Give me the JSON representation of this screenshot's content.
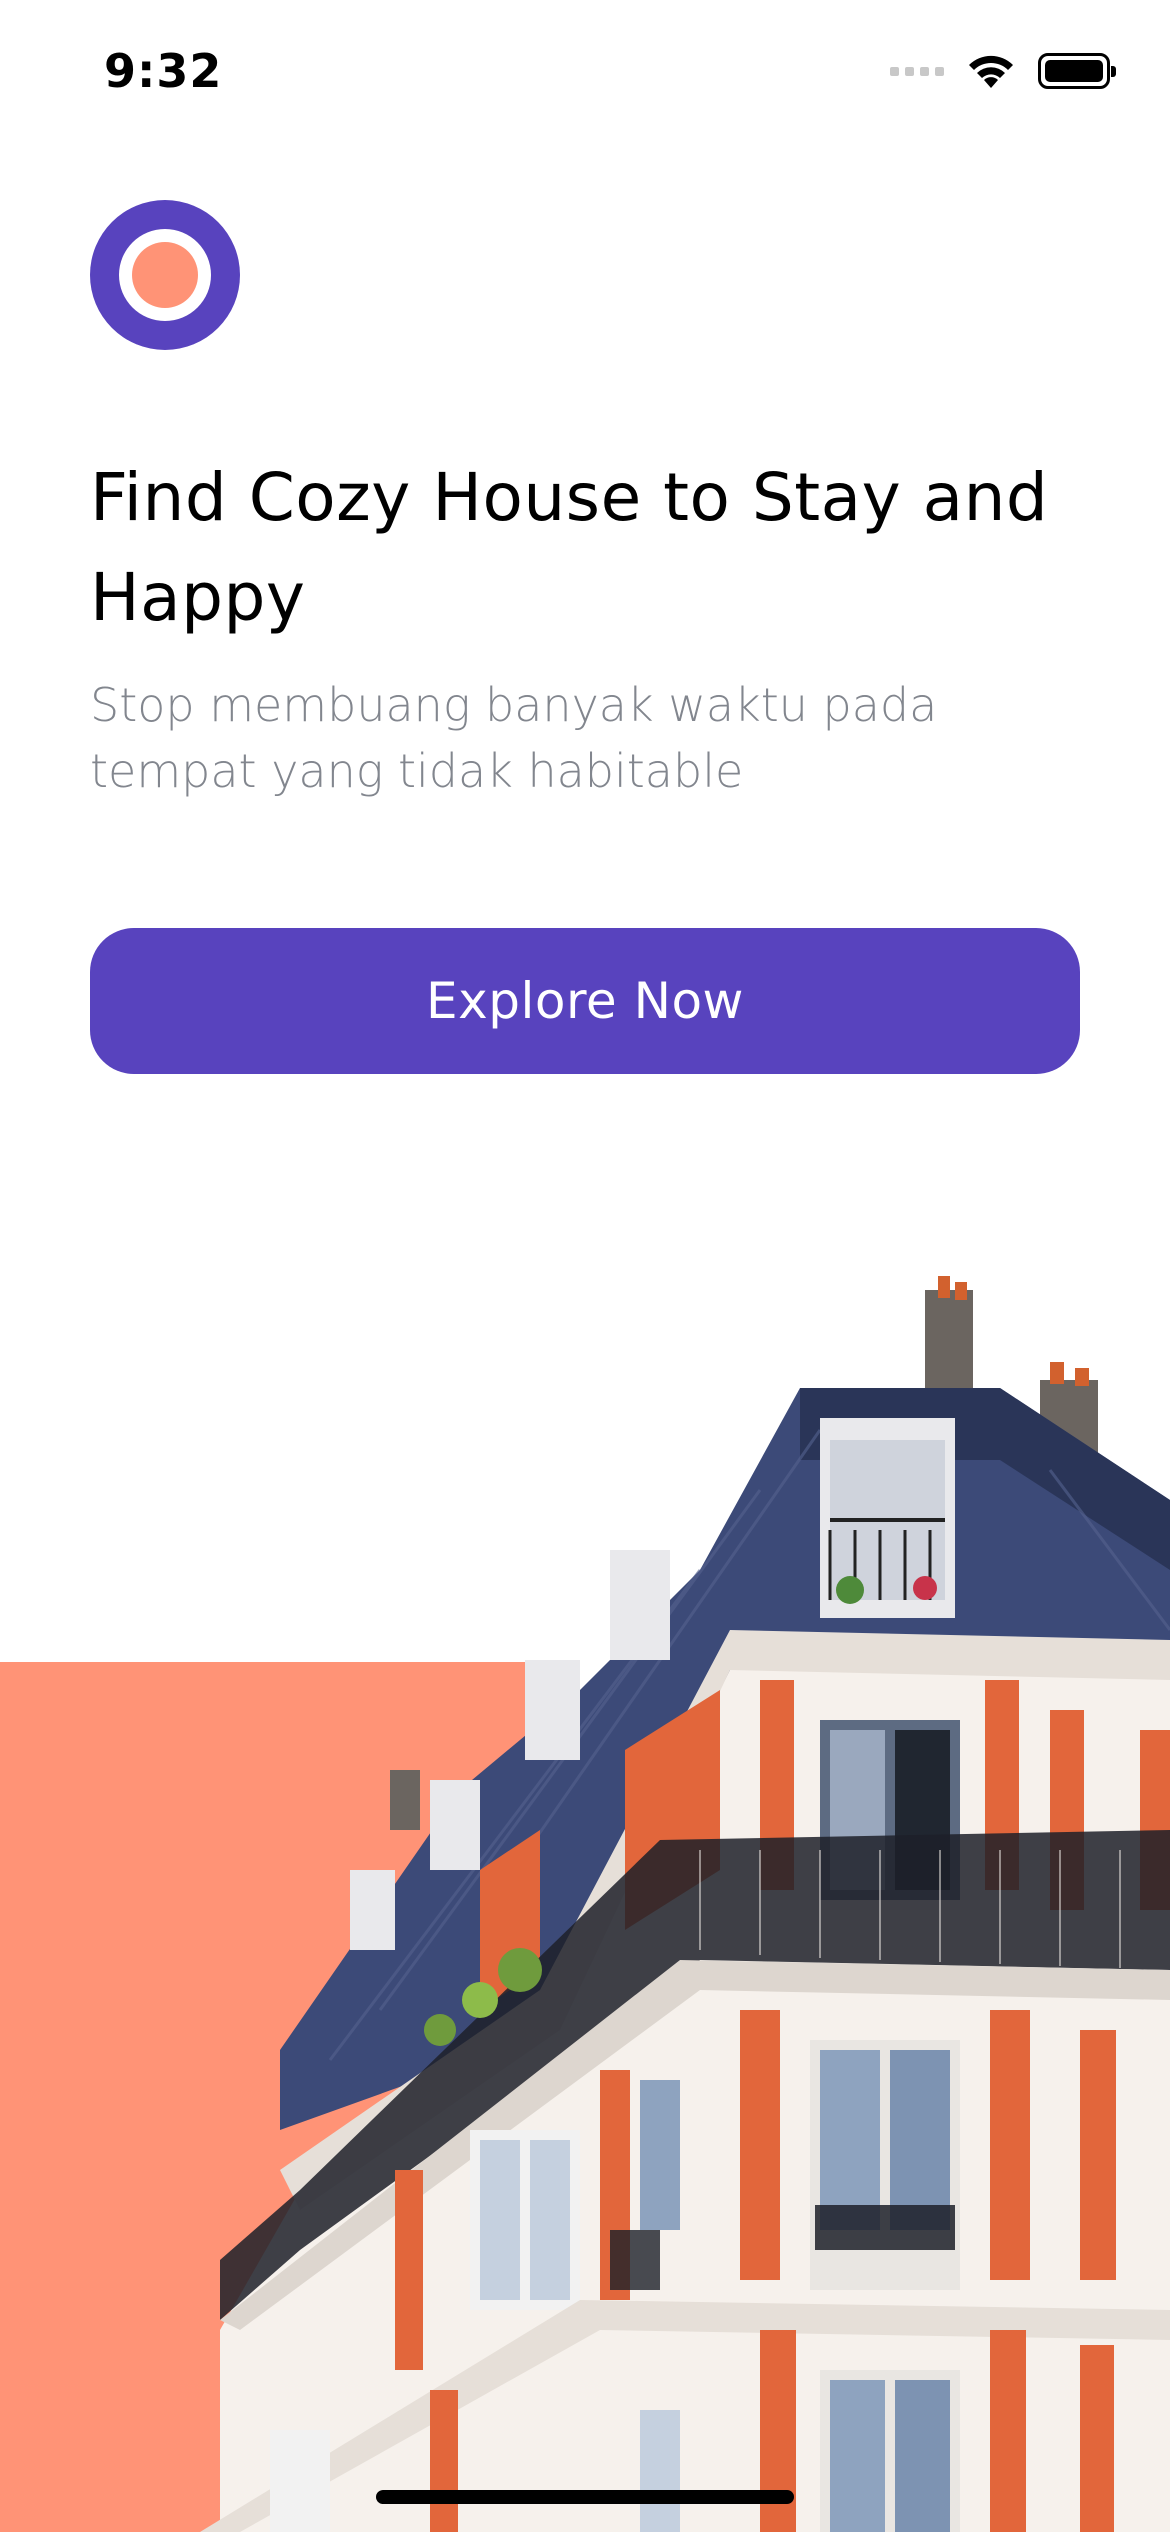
{
  "status_bar": {
    "time": "9:32",
    "icons": [
      "cellular-signal-icon",
      "wifi-icon",
      "battery-icon"
    ]
  },
  "logo": {
    "icon": "app-logo-icon"
  },
  "hero": {
    "title": "Find Cozy House to Stay and Happy",
    "subtitle": "Stop membuang banyak waktu pada tempat yang tidak habitable"
  },
  "cta": {
    "label": "Explore Now"
  },
  "colors": {
    "primary": "#5843BE",
    "accent": "#FF9376",
    "text_primary": "#000000",
    "text_secondary": "#82868E",
    "background": "#FFFFFF"
  }
}
